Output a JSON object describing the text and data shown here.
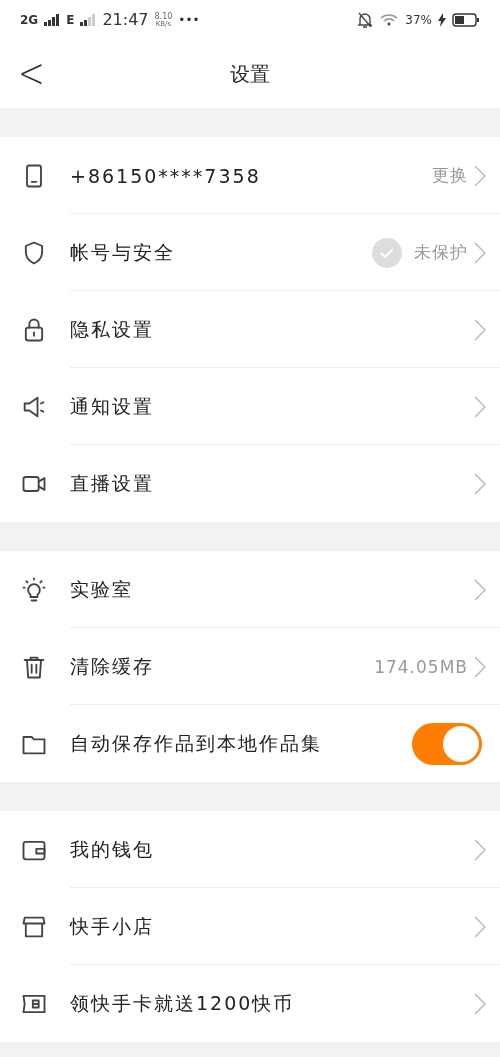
{
  "status_bar": {
    "network_1": "2G",
    "network_2": "E",
    "time": "21:47",
    "speed_value": "8.10",
    "speed_unit": "KB/s",
    "more": "•••",
    "battery": "37%"
  },
  "header": {
    "back": "<",
    "title": "设置"
  },
  "groups": [
    {
      "rows": [
        {
          "kind": "link",
          "label": "+86150****7358",
          "value": "更换"
        },
        {
          "kind": "link",
          "label": "帐号与安全",
          "value": "未保护",
          "badge": true
        },
        {
          "kind": "link",
          "label": "隐私设置"
        },
        {
          "kind": "link",
          "label": "通知设置"
        },
        {
          "kind": "link",
          "label": "直播设置"
        }
      ]
    },
    {
      "rows": [
        {
          "kind": "link",
          "label": "实验室"
        },
        {
          "kind": "link",
          "label": "清除缓存",
          "value": "174.05MB"
        },
        {
          "kind": "toggle",
          "label": "自动保存作品到本地作品集",
          "on": true
        }
      ]
    },
    {
      "rows": [
        {
          "kind": "link",
          "label": "我的钱包"
        },
        {
          "kind": "link",
          "label": "快手小店"
        },
        {
          "kind": "link",
          "label": "领快手卡就送1200快币"
        }
      ]
    }
  ]
}
